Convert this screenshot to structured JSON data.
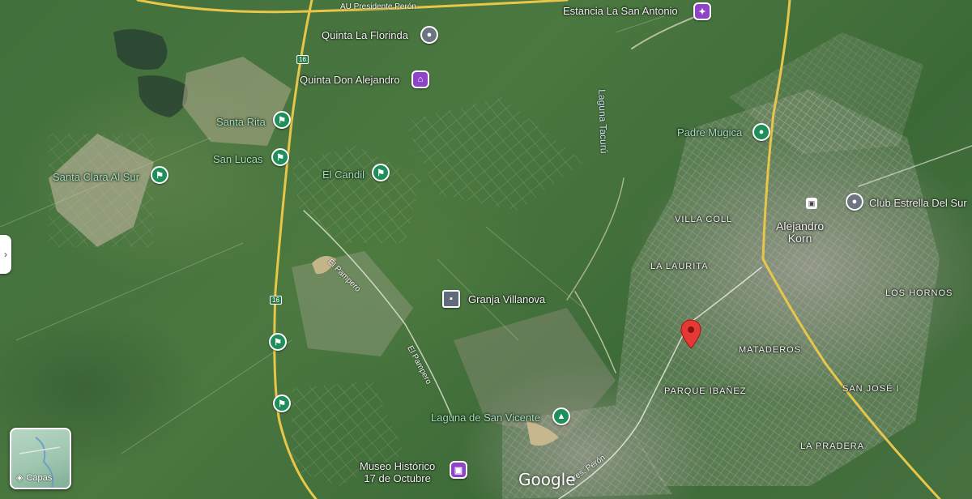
{
  "map": {
    "google_logo": "Google",
    "layers_label": "Capas",
    "roads": [
      {
        "id": "au-presidente-peron",
        "label": "AU Presidente Perón"
      },
      {
        "id": "el-pampero-1",
        "label": "El Pampero"
      },
      {
        "id": "el-pampero-2",
        "label": "El Pampero"
      },
      {
        "id": "pres-peron-south",
        "label": "Pres. Perón"
      }
    ],
    "route_shields": [
      "16",
      "16"
    ],
    "water_features": [
      "Laguna Tacurú"
    ],
    "pois": [
      {
        "id": "estancia-la-san-antonio",
        "label": "Estancia La San Antonio",
        "icon": "purple-activity-icon",
        "color": "#8e44c7"
      },
      {
        "id": "quinta-la-florinda",
        "label": "Quinta La Florinda",
        "icon": "gray-place-icon",
        "color": "#6b7480"
      },
      {
        "id": "quinta-don-alejandro",
        "label": "Quinta Don Alejandro",
        "icon": "purple-lodging-icon",
        "color": "#8e44c7"
      },
      {
        "id": "santa-rita",
        "label": "Santa Rita",
        "icon": "golf-icon",
        "color": "#1e8e5a"
      },
      {
        "id": "san-lucas",
        "label": "San Lucas",
        "icon": "golf-icon",
        "color": "#1e8e5a"
      },
      {
        "id": "santa-clara-al-sur",
        "label": "Santa Clara Al Sur",
        "icon": "golf-icon",
        "color": "#1e8e5a"
      },
      {
        "id": "el-candil",
        "label": "El Candil",
        "icon": "golf-icon",
        "color": "#1e8e5a"
      },
      {
        "id": "padre-mugica",
        "label": "Padre Mugica",
        "icon": "green-place-icon",
        "color": "#1e8e5a"
      },
      {
        "id": "club-estrella-del-sur",
        "label": "Club Estrella Del Sur",
        "icon": "gray-place-icon",
        "color": "#6b7480"
      },
      {
        "id": "granja-villanova",
        "label": "Granja Villanova",
        "icon": "square-place-icon",
        "color": "#5f6b7a"
      },
      {
        "id": "laguna-de-san-vicente",
        "label": "Laguna de San Vicente",
        "icon": "tree-icon",
        "color": "#1e8e5a"
      },
      {
        "id": "museo-historico",
        "label": "Museo Histórico\n17 de Octubre",
        "icon": "purple-museum-icon",
        "color": "#8e44c7"
      },
      {
        "id": "golf-unlabeled-1",
        "label": "",
        "icon": "golf-icon",
        "color": "#1e8e5a"
      },
      {
        "id": "golf-unlabeled-2",
        "label": "",
        "icon": "golf-icon",
        "color": "#1e8e5a"
      }
    ],
    "town": {
      "label": "Alejandro\nKorn",
      "icon": "train-station-icon"
    },
    "neighborhoods": [
      "VILLA COLL",
      "LA LAURITA",
      "LOS HORNOS",
      "MATADEROS",
      "PARQUE IBAÑEZ",
      "SAN JOSÉ I",
      "LA PRADERA"
    ],
    "selected_marker": {
      "color": "#e53935"
    }
  }
}
